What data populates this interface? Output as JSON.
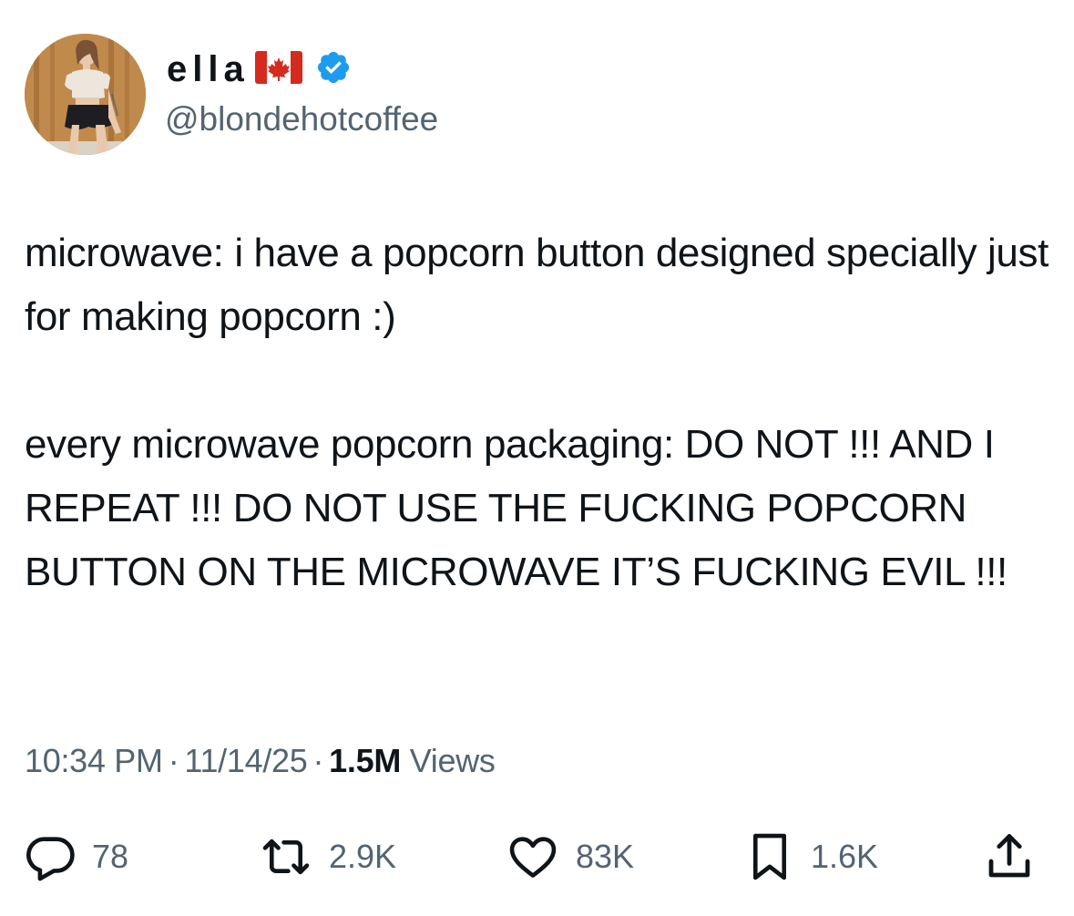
{
  "author": {
    "display_name": "ella",
    "handle": "@blondehotcoffee",
    "flag_icon": "canada-flag-icon",
    "verified_icon": "verified-badge-icon",
    "verified_color": "#1d9bf0"
  },
  "tweet": {
    "paragraphs": [
      "microwave: i have a popcorn button designed specially just for making popcorn :)",
      "every microwave popcorn packaging: DO NOT !!! AND I REPEAT !!! DO NOT USE THE FUCKING POPCORN BUTTON ON THE MICROWAVE IT’S FUCKING EVIL !!!"
    ]
  },
  "meta": {
    "time": "10:34 PM",
    "separator": "·",
    "date": "11/14/25",
    "views_count": "1.5M",
    "views_label": "Views"
  },
  "actions": {
    "reply": {
      "icon": "reply-icon",
      "count": "78"
    },
    "repost": {
      "icon": "repost-icon",
      "count": "2.9K"
    },
    "like": {
      "icon": "heart-icon",
      "count": "83K"
    },
    "bookmark": {
      "icon": "bookmark-icon",
      "count": "1.6K"
    },
    "share": {
      "icon": "share-icon"
    }
  },
  "colors": {
    "text": "#0f1419",
    "secondary_text": "#536471",
    "background": "#ffffff"
  }
}
